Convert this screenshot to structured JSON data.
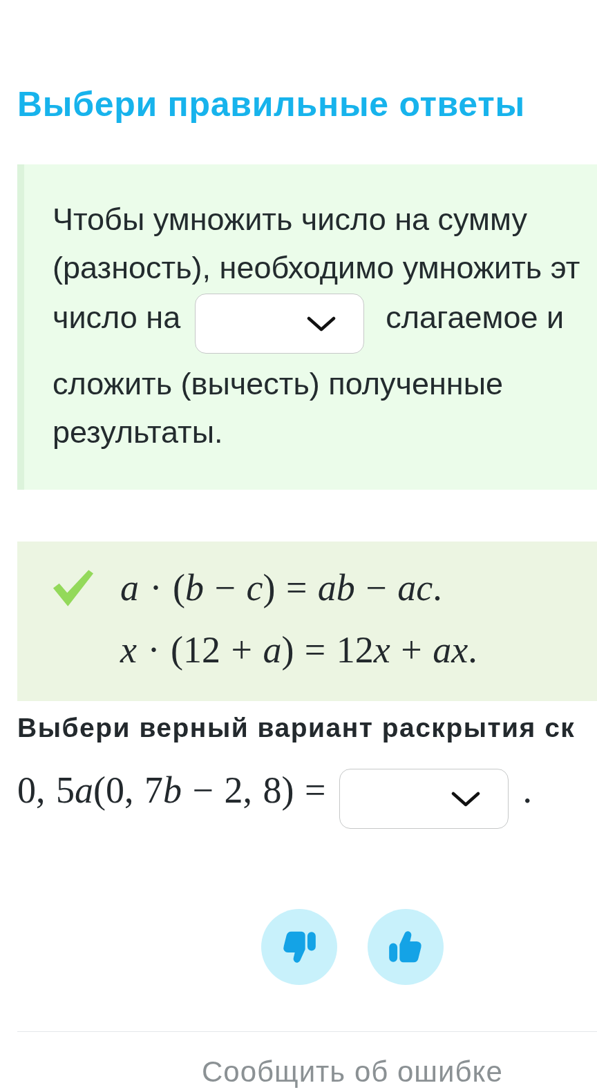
{
  "title": "Выбери правильные ответы",
  "rule": {
    "lines": [
      {
        "parts": [
          {
            "kind": "text",
            "text": "Чтобы умножить число на сумму"
          }
        ]
      },
      {
        "parts": [
          {
            "kind": "text",
            "text": "(разность), необходимо умножить эт"
          }
        ]
      },
      {
        "parts": [
          {
            "kind": "text",
            "text": "число на"
          },
          {
            "kind": "dropdown"
          },
          {
            "kind": "text",
            "text": "слагаемое и"
          }
        ]
      },
      {
        "parts": [
          {
            "kind": "text",
            "text": "сложить (вычесть) полученные"
          }
        ]
      },
      {
        "parts": [
          {
            "kind": "text",
            "text": "результаты."
          }
        ]
      }
    ]
  },
  "example": {
    "correct": true,
    "formulas": [
      {
        "pieces": [
          "*a* · (*b* − *c*) = *ab* − *ac*."
        ]
      },
      {
        "pieces": [
          "*x* · (12 + *a*) = 12",
          "*x* + *ax*."
        ]
      }
    ]
  },
  "question": {
    "prompt": "Выбери верный вариант раскрытия ск",
    "parts": [
      {
        "kind": "formula",
        "pieces": [
          "0, 5",
          "*a*(0, 7",
          "*b* − 2, 8) ="
        ]
      },
      {
        "kind": "dropdown"
      },
      {
        "kind": "formula",
        "pieces": [
          "."
        ]
      }
    ]
  },
  "report_link": "Сообщить об ошибке"
}
